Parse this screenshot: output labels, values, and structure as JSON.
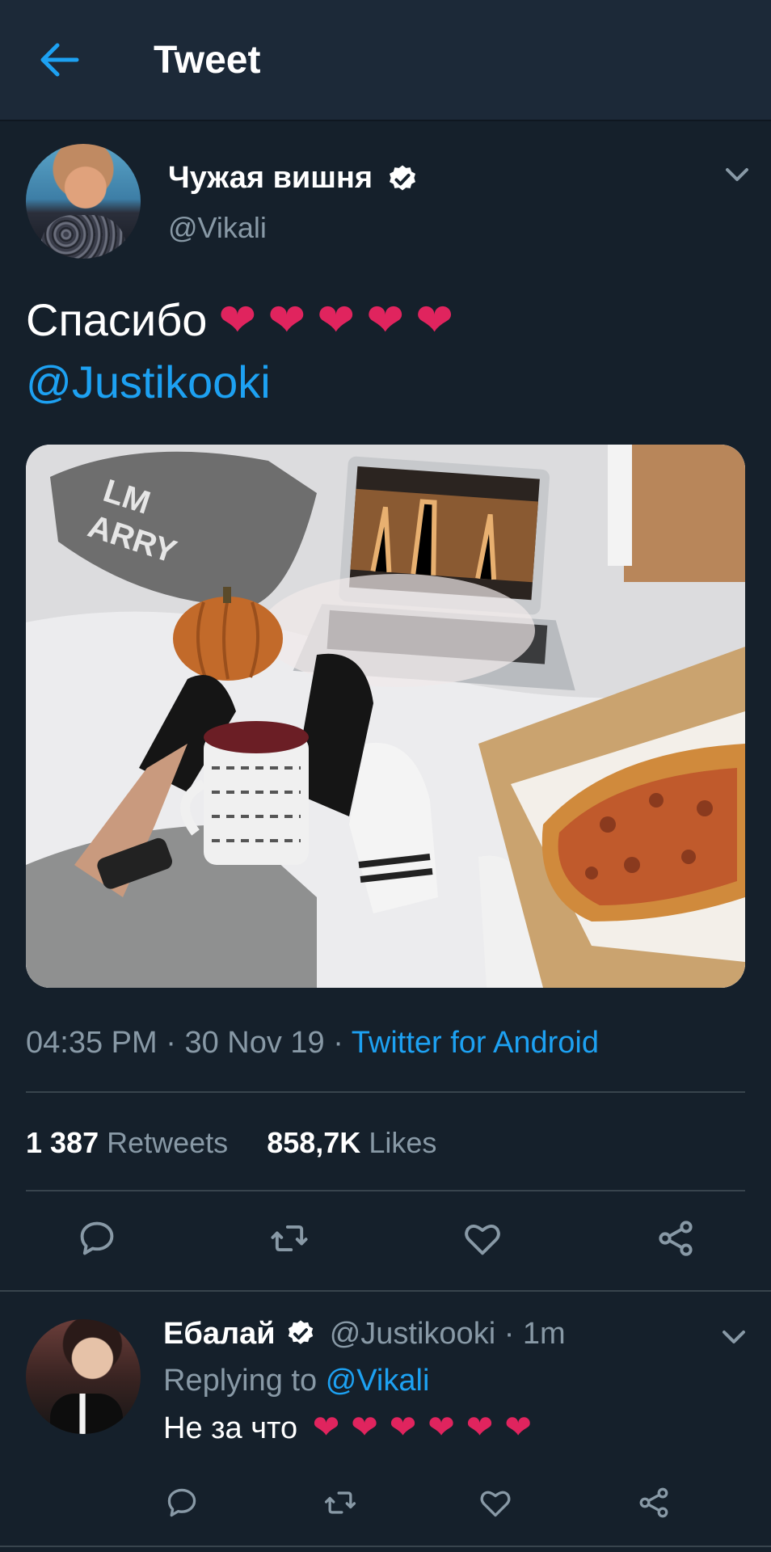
{
  "header": {
    "title": "Tweet"
  },
  "tweet": {
    "author_name": "Чужая вишня",
    "author_handle": "@Vikali",
    "text": "Спасибо",
    "hearts": [
      "❤",
      "❤",
      "❤",
      "❤",
      "❤"
    ],
    "mention": "@Justikooki",
    "time": "04:35 PM",
    "date": "30 Nov 19",
    "source": "Twitter for Android",
    "retweets_count": "1 387",
    "retweets_label": "Retweets",
    "likes_count": "858,7K",
    "likes_label": "Likes"
  },
  "reply": {
    "author_name": "Ебалай",
    "author_handle": "@Justikooki",
    "time": "1m",
    "replying_to_label": "Replying to",
    "replying_to_handle": "@Vikali",
    "text": "Не за что",
    "hearts": [
      "❤",
      "❤",
      "❤",
      "❤",
      "❤",
      "❤"
    ]
  },
  "icons": {
    "back": "arrow-left-icon",
    "verified": "verified-badge-icon",
    "chevron": "chevron-down-icon",
    "reply": "reply-icon",
    "retweet": "retweet-icon",
    "like": "heart-outline-icon",
    "share": "share-icon"
  },
  "colors": {
    "background": "#15202b",
    "header": "#1c2938",
    "accent": "#1da1f2",
    "secondary_text": "#8899a6",
    "heart": "#e0245e"
  }
}
